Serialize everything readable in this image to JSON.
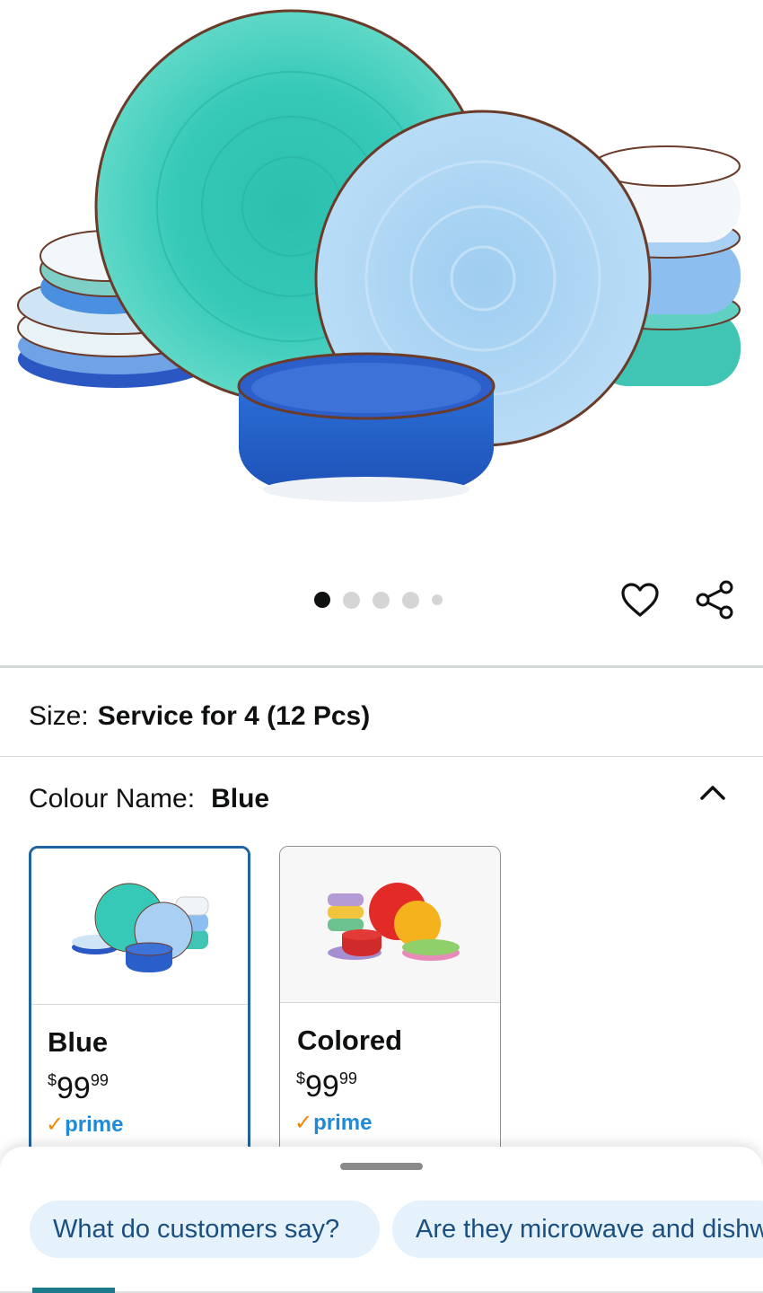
{
  "product_image": {
    "alt": "Blue dinnerware set"
  },
  "carousel": {
    "total_images": 5,
    "active_index": 0
  },
  "actions": {
    "wishlist_icon": "heart-icon",
    "share_icon": "share-icon"
  },
  "size": {
    "label": "Size:",
    "value": "Service for 4 (12 Pcs)"
  },
  "colour": {
    "label": "Colour Name:",
    "value": "Blue",
    "collapse_icon": "chevron-up-icon"
  },
  "swatches": [
    {
      "name": "Blue",
      "currency": "$",
      "price_whole": "99",
      "price_fraction": "99",
      "prime_label": "prime",
      "selected": true
    },
    {
      "name": "Colored",
      "currency": "$",
      "price_whole": "99",
      "price_fraction": "99",
      "prime_label": "prime",
      "selected": false
    }
  ],
  "suggestions": [
    {
      "label": "What do customers say?"
    },
    {
      "label": "Are they microwave and dishwasher safe?"
    }
  ],
  "colors": {
    "accent": "#2162a1",
    "prime": "#1f8ad8",
    "prime_check": "#f08804",
    "chip_bg": "#e6f2fb",
    "chip_text": "#1a4f80"
  }
}
